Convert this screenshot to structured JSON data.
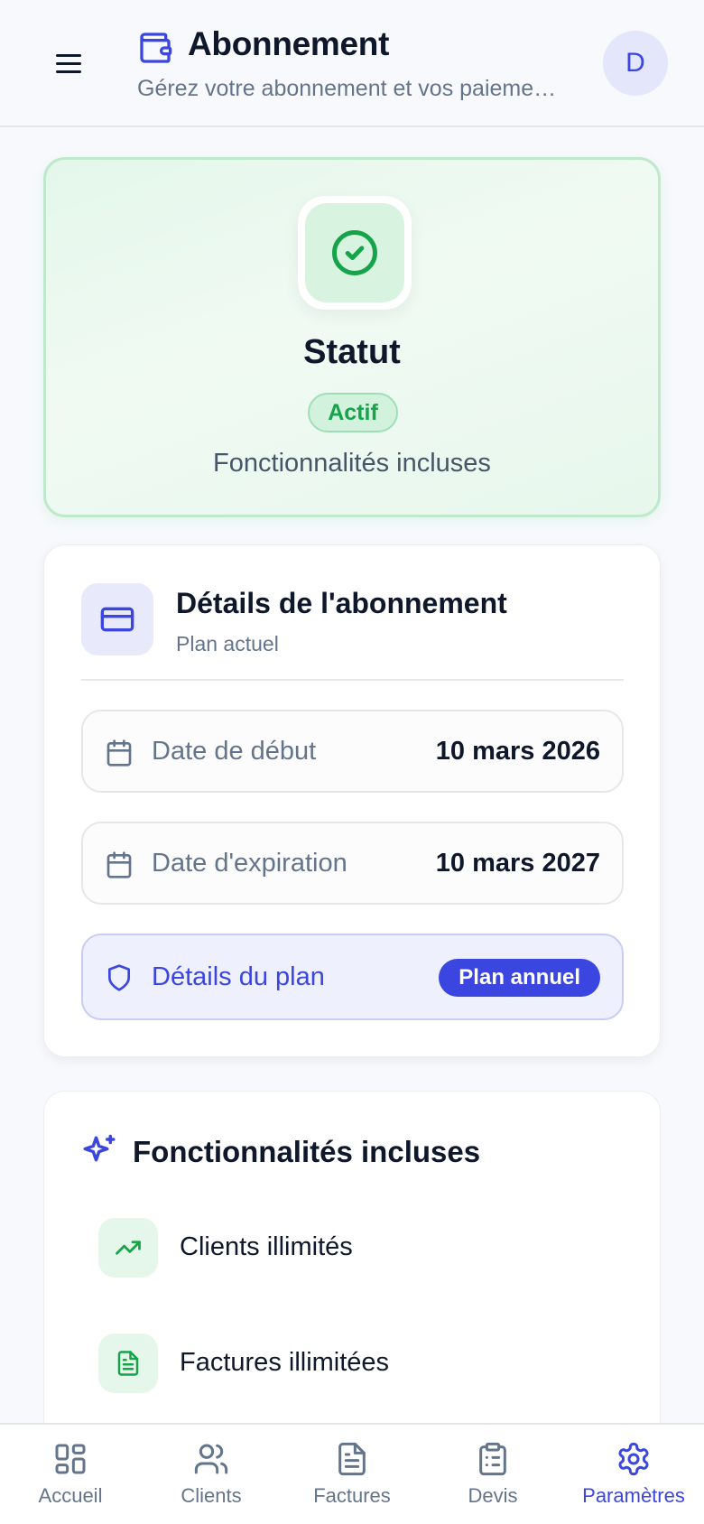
{
  "header": {
    "title": "Abonnement",
    "subtitle": "Gérez votre abonnement et vos paiements",
    "avatar_initial": "D",
    "icon": "wallet-icon",
    "menu_icon": "menu-icon"
  },
  "status": {
    "icon": "check-circle-icon",
    "title": "Statut",
    "badge": "Actif",
    "subtitle": "Fonctionnalités incluses"
  },
  "details": {
    "icon": "credit-card-icon",
    "title": "Détails de l'abonnement",
    "subtitle": "Plan actuel",
    "start": {
      "icon": "calendar-icon",
      "label": "Date de début",
      "value": "10 mars 2026"
    },
    "expiry": {
      "icon": "calendar-icon",
      "label": "Date d'expiration",
      "value": "10 mars 2027"
    },
    "plan": {
      "icon": "shield-icon",
      "label": "Détails du plan",
      "badge": "Plan annuel"
    }
  },
  "features": {
    "icon": "sparkles-icon",
    "title": "Fonctionnalités incluses",
    "items": [
      {
        "icon": "trending-up-icon",
        "label": "Clients illimités"
      },
      {
        "icon": "file-text-icon",
        "label": "Factures illimitées"
      }
    ]
  },
  "nav": {
    "items": [
      {
        "icon": "grid-icon",
        "label": "Accueil"
      },
      {
        "icon": "users-icon",
        "label": "Clients"
      },
      {
        "icon": "file-text-icon",
        "label": "Factures"
      },
      {
        "icon": "clipboard-list-icon",
        "label": "Devis"
      },
      {
        "icon": "gear-icon",
        "label": "Paramètres"
      }
    ],
    "active": "Paramètres"
  },
  "colors": {
    "accent": "#3b46e0",
    "success": "#22c55e",
    "success_dark": "#16a34a",
    "text": "#0f172a",
    "muted": "#64748b"
  }
}
